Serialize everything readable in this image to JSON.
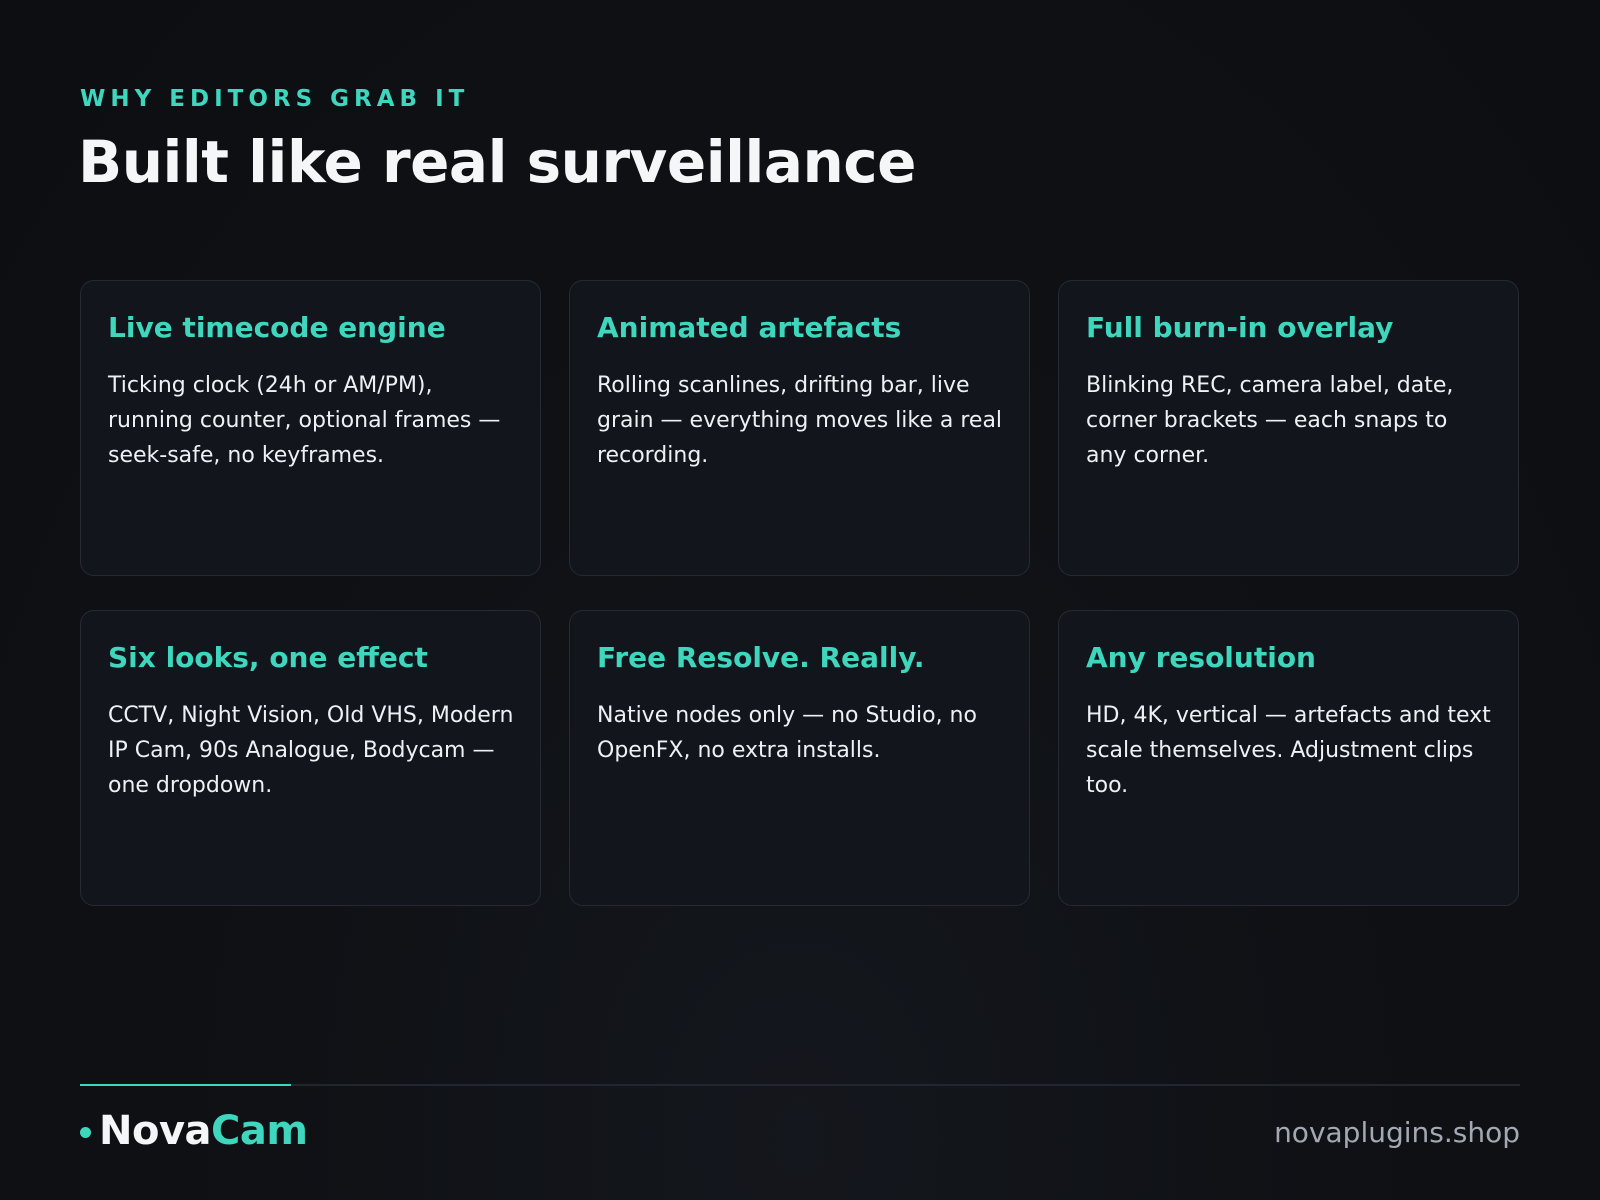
{
  "header": {
    "eyebrow": "WHY EDITORS GRAB IT",
    "title": "Built like real surveillance"
  },
  "features": [
    {
      "title": "Live timecode engine",
      "body": "Ticking clock (24h or AM/PM), running counter, optional frames — seek-safe, no keyframes."
    },
    {
      "title": "Animated artefacts",
      "body": "Rolling scanlines, drifting bar, live grain — everything moves like a real recording."
    },
    {
      "title": "Full burn-in overlay",
      "body": "Blinking REC, camera label, date, corner brackets — each snaps to any corner."
    },
    {
      "title": "Six looks, one effect",
      "body": "CCTV, Night Vision, Old VHS, Modern IP Cam, 90s Analogue, Bodycam — one dropdown."
    },
    {
      "title": "Free Resolve. Really.",
      "body": "Native nodes only — no Studio, no OpenFX, no extra installs."
    },
    {
      "title": "Any resolution",
      "body": "HD, 4K, vertical — artefacts and text scale themselves. Adjustment clips too."
    }
  ],
  "footer": {
    "brand_part1": "Nova",
    "brand_part2": "Cam",
    "url": "novaplugins.shop"
  },
  "colors": {
    "accent": "#3fd6be",
    "background": "#0f1115",
    "card": "#12151c",
    "text": "#f4f6f8",
    "muted": "#a3a8b2"
  }
}
